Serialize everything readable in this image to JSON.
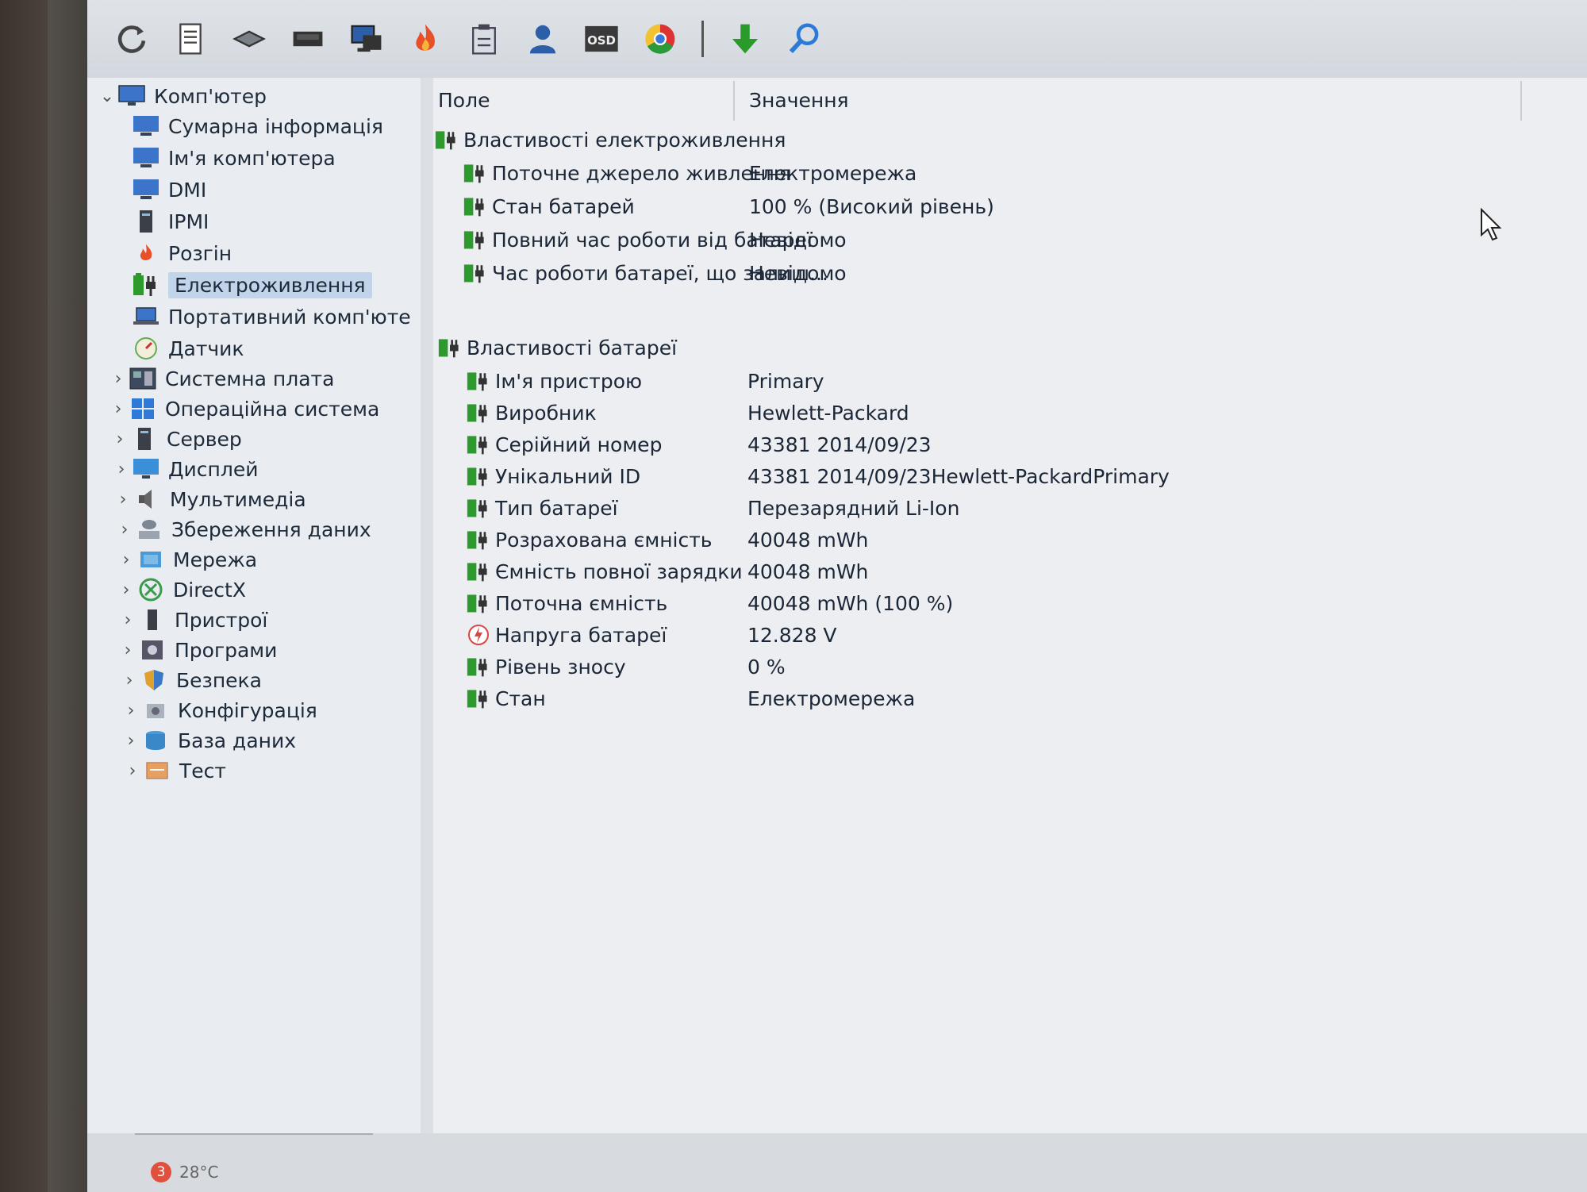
{
  "toolbar": {
    "icons": [
      "refresh-icon",
      "report-icon",
      "memory-icon",
      "chip-icon",
      "computer-icon",
      "flame-icon",
      "clipboard-icon",
      "user-icon",
      "osd-icon",
      "chrome-icon",
      "download-arrow-icon",
      "search-icon"
    ],
    "osd_label": "OSD"
  },
  "tree": {
    "root": "Комп'ютер",
    "children": [
      "Сумарна інформація",
      "Ім'я комп'ютера",
      "DMI",
      "IPMI",
      "Розгін",
      "Електроживлення",
      "Портативний комп'юте",
      "Датчик"
    ],
    "top_level": [
      "Системна плата",
      "Операційна система",
      "Сервер",
      "Дисплей",
      "Мультимедіа",
      "Збереження даних",
      "Мережа",
      "DirectX",
      "Пристрої",
      "Програми",
      "Безпека",
      "Конфігурація",
      "База даних",
      "Тест"
    ]
  },
  "list": {
    "columns": {
      "field": "Поле",
      "value": "Значення"
    },
    "group1": {
      "title": "Властивості електроживлення",
      "rows": [
        {
          "field": "Поточне джерело живлення",
          "value": "Електромережа"
        },
        {
          "field": "Стан батарей",
          "value": "100 % (Високий рівень)"
        },
        {
          "field": "Повний час роботи від батареї",
          "value": "Невідомо"
        },
        {
          "field": "Час роботи батареї, що залиш...",
          "value": "Невідомо"
        }
      ]
    },
    "group2": {
      "title": "Властивості батареї",
      "rows": [
        {
          "field": "Ім'я пристрою",
          "value": "Primary"
        },
        {
          "field": "Виробник",
          "value": "Hewlett-Packard"
        },
        {
          "field": "Серійний номер",
          "value": "43381 2014/09/23"
        },
        {
          "field": "Унікальний ID",
          "value": "43381 2014/09/23Hewlett-PackardPrimary"
        },
        {
          "field": "Тип батареї",
          "value": "Перезарядний Li-Ion"
        },
        {
          "field": "Розрахована ємність",
          "value": "40048 mWh"
        },
        {
          "field": "Ємність повної зарядки",
          "value": "40048 mWh"
        },
        {
          "field": "Поточна ємність",
          "value": "40048 mWh  (100 %)"
        },
        {
          "field": "Напруга батареї",
          "value": "12.828 V"
        },
        {
          "field": "Рівень зносу",
          "value": "0 %"
        },
        {
          "field": "Стан",
          "value": "Електромережа"
        }
      ]
    }
  },
  "taskbar": {
    "weather_badge": "3",
    "temperature": "28°C"
  },
  "colors": {
    "battery_green": "#2e9a2e",
    "selection": "#c2d4ea",
    "text": "#1b2636"
  }
}
